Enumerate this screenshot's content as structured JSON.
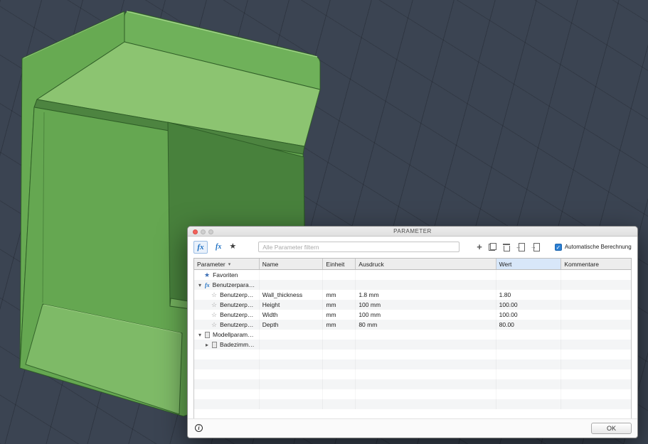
{
  "viewport": {
    "bg_color": "#3b4452",
    "model_color": "#6fb15a",
    "model_description": "green open-front shelf box with raised back panel"
  },
  "icons": {
    "fx": "fx",
    "star_filled": "★",
    "star_outline": "☆",
    "caret_down": "▾",
    "caret_right": "▸",
    "chevron_down": "▾",
    "plus": "+",
    "check": "✓",
    "info": "i"
  },
  "dialog": {
    "title": "PARAMETER",
    "toolbar": {
      "search_placeholder": "Alle Parameter filtern",
      "auto_calc_label": "Automatische Berechnung",
      "auto_calc_checked": true
    },
    "table": {
      "columns": [
        "Parameter",
        "Name",
        "Einheit",
        "Ausdruck",
        "Wert",
        "Kommentare"
      ],
      "rows": [
        {
          "kind": "favorites",
          "label": "Favoriten"
        },
        {
          "kind": "group-user",
          "label": "Benutzerpara…"
        },
        {
          "kind": "param",
          "label": "Benutzerp…",
          "name": "Wall_thickness",
          "unit": "mm",
          "expression": "1.8 mm",
          "value": "1.80",
          "comment": ""
        },
        {
          "kind": "param",
          "label": "Benutzerp…",
          "name": "Height",
          "unit": "mm",
          "expression": "100 mm",
          "value": "100.00",
          "comment": ""
        },
        {
          "kind": "param",
          "label": "Benutzerp…",
          "name": "Width",
          "unit": "mm",
          "expression": "100 mm",
          "value": "100.00",
          "comment": ""
        },
        {
          "kind": "param",
          "label": "Benutzerp…",
          "name": "Depth",
          "unit": "mm",
          "expression": "80 mm",
          "value": "80.00",
          "comment": ""
        },
        {
          "kind": "group-model",
          "label": "Modellparam…"
        },
        {
          "kind": "model-child",
          "label": "Badezimm…"
        }
      ]
    },
    "footer": {
      "ok_label": "OK"
    }
  }
}
